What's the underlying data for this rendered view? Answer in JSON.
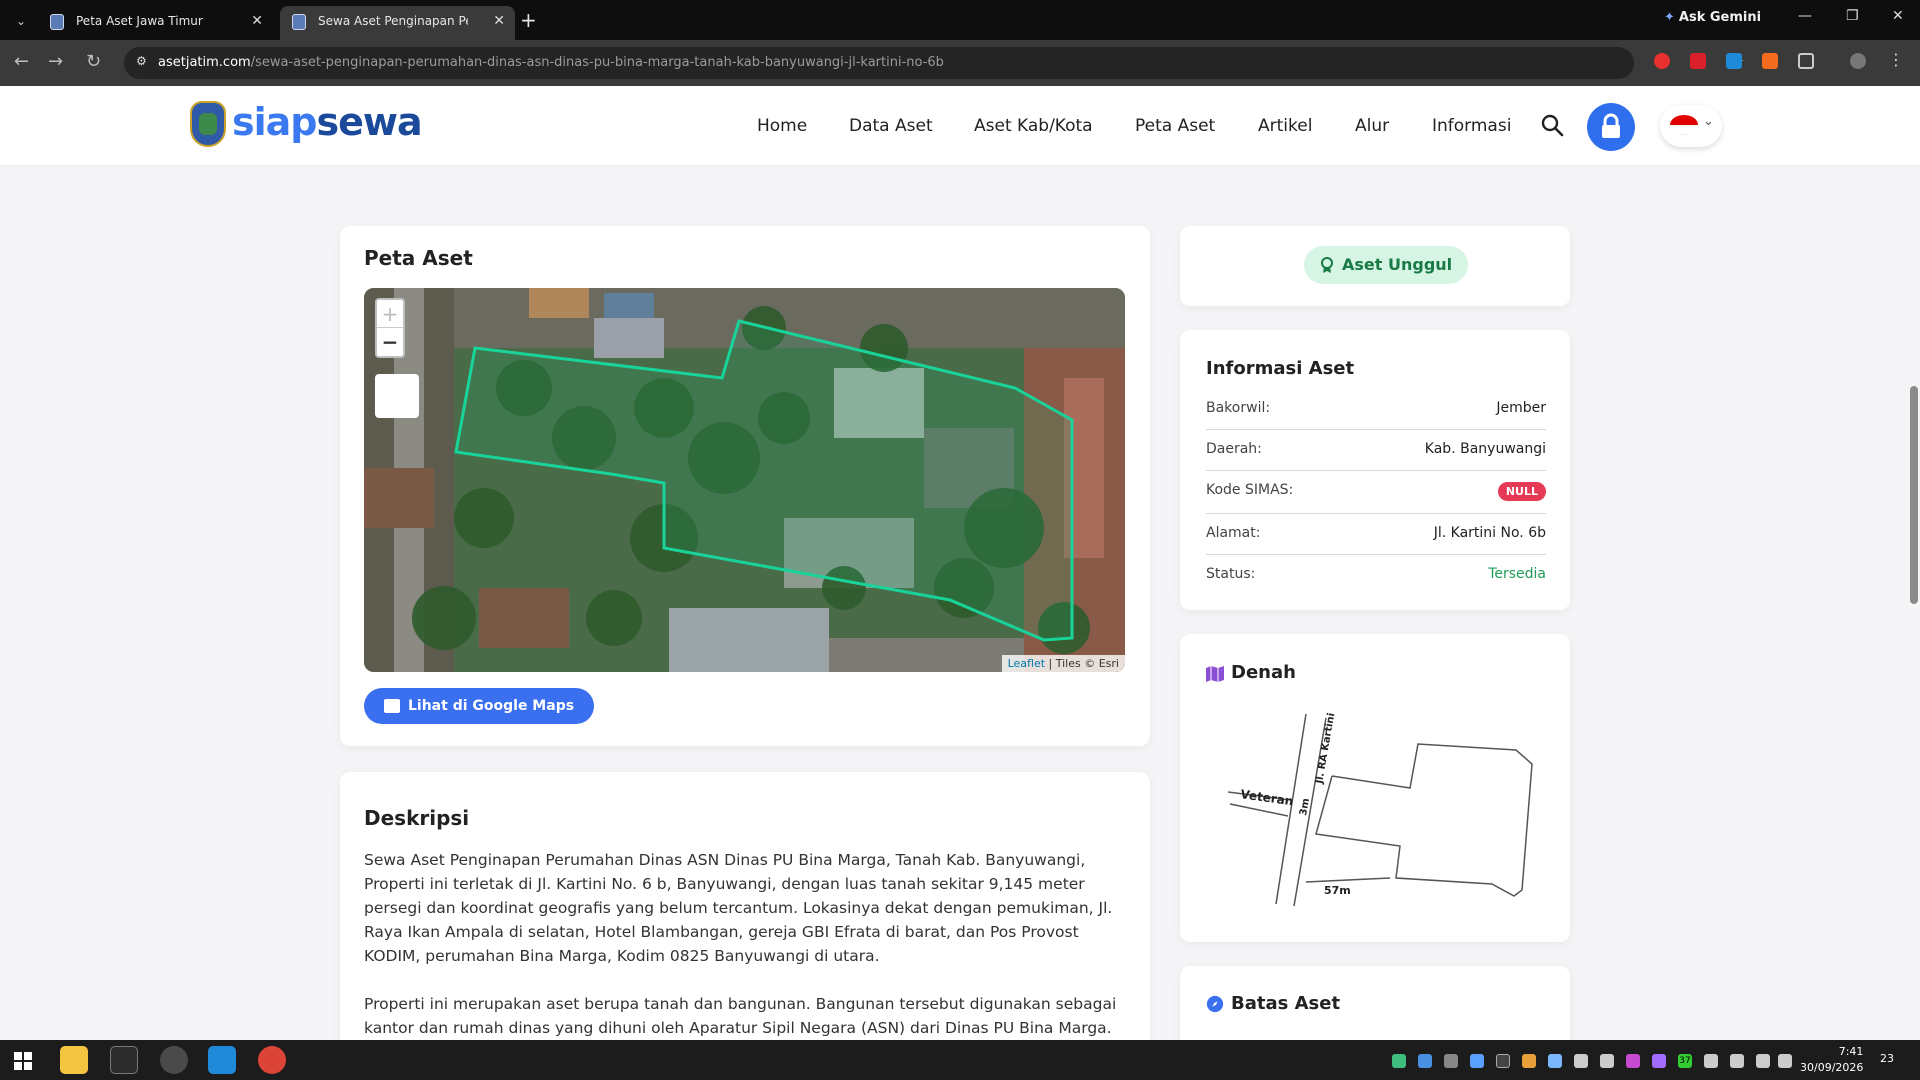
{
  "browser": {
    "tabs": [
      {
        "title": "Peta Aset Jawa Timur"
      },
      {
        "title": "Sewa Aset Penginapan Perumah"
      }
    ],
    "gemini_label": "Ask Gemini",
    "url_domain": "asetjatim.com",
    "url_path": "/sewa-aset-penginapan-perumahan-dinas-asn-dinas-pu-bina-marga-tanah-kab-banyuwangi-jl-kartini-no-6b"
  },
  "site": {
    "logo_siap": "siap",
    "logo_sewa": "sewa",
    "nav": [
      "Home",
      "Data Aset",
      "Aset Kab/Kota",
      "Peta Aset",
      "Artikel",
      "Alur",
      "Informasi"
    ]
  },
  "map_card": {
    "title": "Peta Aset",
    "zoom_in": "+",
    "zoom_out": "−",
    "attribution_link": "Leaflet",
    "attribution_rest": " | Tiles © Esri",
    "button": "Lihat di Google Maps"
  },
  "description": {
    "title": "Deskripsi",
    "paragraphs": [
      "Sewa Aset Penginapan Perumahan Dinas ASN Dinas PU Bina Marga, Tanah Kab. Banyuwangi, Properti ini terletak di Jl. Kartini No. 6 b, Banyuwangi, dengan luas tanah sekitar 9,145 meter persegi dan koordinat geografis yang belum tercantum. Lokasinya dekat dengan pemukiman, Jl. Raya Ikan Ampala di selatan, Hotel Blambangan, gereja GBI Efrata di barat, dan Pos Provost KODIM, perumahan Bina Marga, Kodim 0825 Banyuwangi di utara.",
      "Properti ini merupakan aset berupa tanah dan bangunan. Bangunan tersebut digunakan sebagai kantor dan rumah dinas yang dihuni oleh Aparatur Sipil Negara (ASN) dari Dinas PU Bina Marga. Selain itu,"
    ]
  },
  "badge": {
    "label": "Aset Unggul"
  },
  "info": {
    "title": "Informasi Aset",
    "rows": [
      {
        "key": "Bakorwil:",
        "value": "Jember"
      },
      {
        "key": "Daerah:",
        "value": "Kab. Banyuwangi"
      },
      {
        "key": "Kode SIMAS:",
        "value": "NULL"
      },
      {
        "key": "Alamat:",
        "value": "Jl. Kartini No. 6b"
      },
      {
        "key": "Status:",
        "value": "Tersedia"
      }
    ],
    "status_color": "#1f9b5a",
    "null_color": "#e53955"
  },
  "denah": {
    "title": "Denah",
    "labels": {
      "veteran": "Veteran",
      "kartini": "Jl. RA Kartini",
      "width_label": "3m",
      "length_label": "57m"
    }
  },
  "batas": {
    "title": "Batas Aset"
  },
  "taskbar": {
    "time": "7:41",
    "date": "30/09/2026",
    "notifications": "23",
    "tray_temp": "37"
  },
  "colors": {
    "accent": "#3a6ff0",
    "brand_dark": "#1c4a9a",
    "polygon": "#19d49a"
  }
}
